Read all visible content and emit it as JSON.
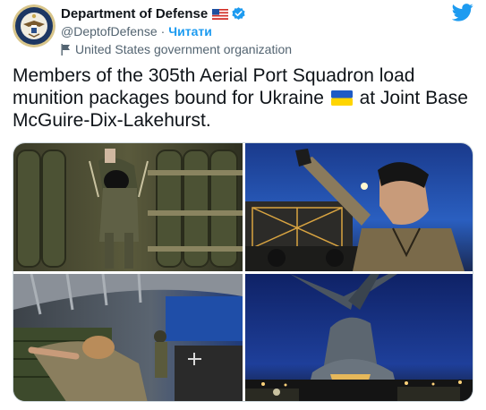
{
  "author": {
    "name": "Department of Defense",
    "handle": "@DeptofDefense",
    "separator": "·",
    "follow_label": "Читати",
    "org_label": "United States government organization"
  },
  "icons": {
    "avatar": "dod-seal-avatar",
    "country": "us-flag-icon",
    "verified": "verified-badge-icon",
    "org": "flag-icon",
    "brand": "twitter-bird-icon",
    "emoji": "ukraine-flag-emoji"
  },
  "tweet": {
    "text_before": "Members of the 305th Aerial Port Squadron load munition packages bound for Ukraine",
    "text_after": "at Joint Base McGuire-Dix-Lakehurst."
  },
  "media": {
    "photos": [
      "airman-loading-munitions-photo",
      "airman-thumbs-up-photo",
      "airman-pushing-pallet-photo",
      "c17-aircraft-night-photo"
    ]
  },
  "colors": {
    "accent": "#1d9bf0",
    "text": "#0f1419",
    "secondary": "#536471"
  }
}
